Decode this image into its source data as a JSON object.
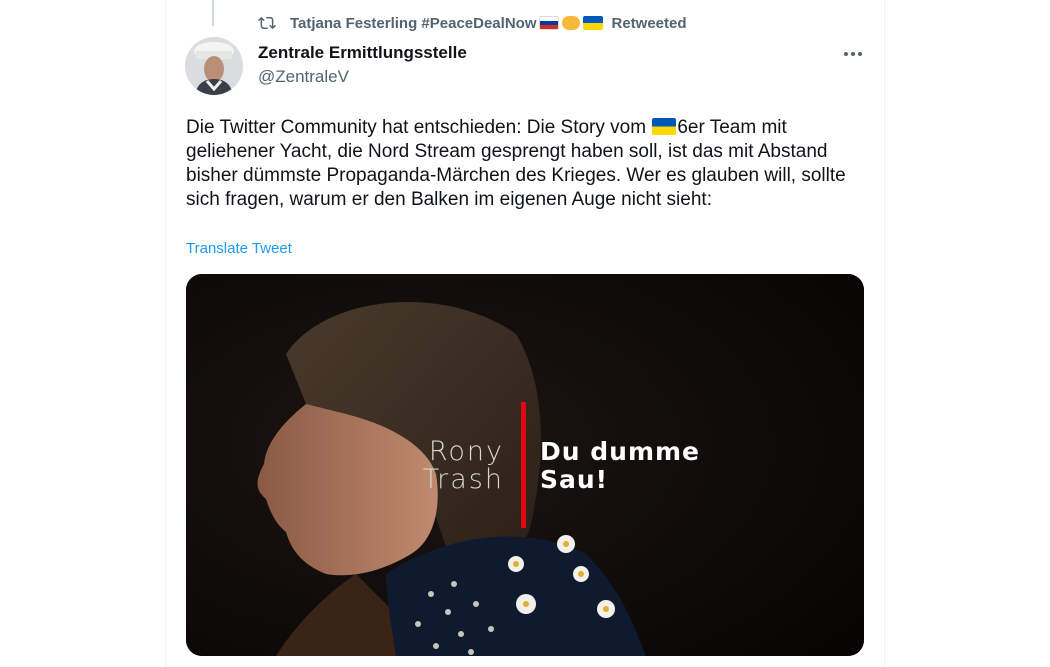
{
  "retweet": {
    "user_name": "Tatjana Festerling #PeaceDealNow",
    "suffix": "Retweeted",
    "icon": "retweet-icon"
  },
  "author": {
    "name": "Zentrale Ermittlungsstelle",
    "handle": "@ZentraleV"
  },
  "tweet": {
    "text_before_flag": "Die Twitter Community hat entschieden: Die Story vom ",
    "text_after_flag": "6er Team mit geliehener Yacht, die Nord Stream gesprengt haben soll, ist das mit Abstand bisher dümmste Propaganda-Märchen des Krieges. Wer es glauben will, sollte sich fragen, warum er den Balken im eigenen Auge nicht sieht:",
    "translate_label": "Translate Tweet"
  },
  "media": {
    "caption_left_line1": "Rony",
    "caption_left_line2": "Trash",
    "caption_right_line1": "Du dumme",
    "caption_right_line2": "Sau!"
  },
  "colors": {
    "link": "#1d9bf0",
    "secondary": "#536471",
    "accent_red": "#e30613"
  }
}
